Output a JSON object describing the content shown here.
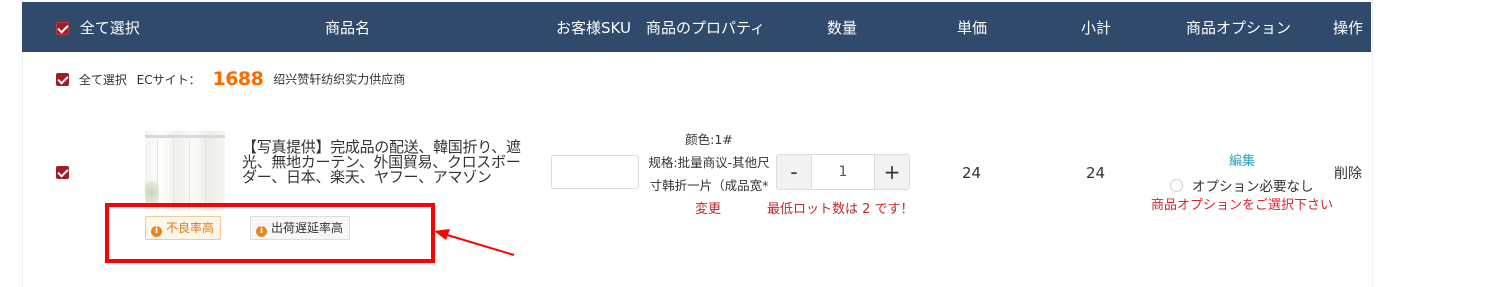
{
  "header": {
    "select_all": "全て選択",
    "product_name": "商品名",
    "customer_sku": "お客様SKU",
    "product_property": "商品のプロパティ",
    "quantity": "数量",
    "unit_price": "単価",
    "subtotal": "小計",
    "product_option": "商品オプション",
    "operation": "操作"
  },
  "shop": {
    "select_all": "全て選択",
    "ec_site_label": "ECサイト：",
    "platform_logo": "1688",
    "shop_name": "绍兴赞轩纺织实力供应商"
  },
  "item": {
    "title": "【写真提供】完成品の配送、韓国折り、遮光、無地カーテン、外国貿易、クロスボーダー、日本、楽天、ヤフー、アマゾン",
    "badges": [
      "不良率高",
      "出荷遅延率高"
    ],
    "sku_value": "",
    "properties": [
      "颜色:1#",
      "规格:批量商议-其他尺",
      "寸韩折一片（成品宽*"
    ],
    "change_label": "変更",
    "quantity": "1",
    "minus_label": "-",
    "plus_label": "+",
    "min_lot_warning": "最低ロット数は 2 です！",
    "unit_price": "24",
    "subtotal": "24",
    "option_edit": "編集",
    "option_none": "オプション必要なし",
    "option_warning": "商品オプションをご選択下さい",
    "delete_label": "削除"
  },
  "colors": {
    "header_bg": "#2f4a6b",
    "accent_red": "#a01d23",
    "warning_red": "#d9262c",
    "link_blue": "#2a9fbe",
    "logo_orange": "#ff6a00",
    "annotation_red": "#ff0000"
  },
  "icons": [
    "checkbox-checked-icon",
    "info-icon",
    "radio-icon",
    "annotation-arrow-icon"
  ]
}
